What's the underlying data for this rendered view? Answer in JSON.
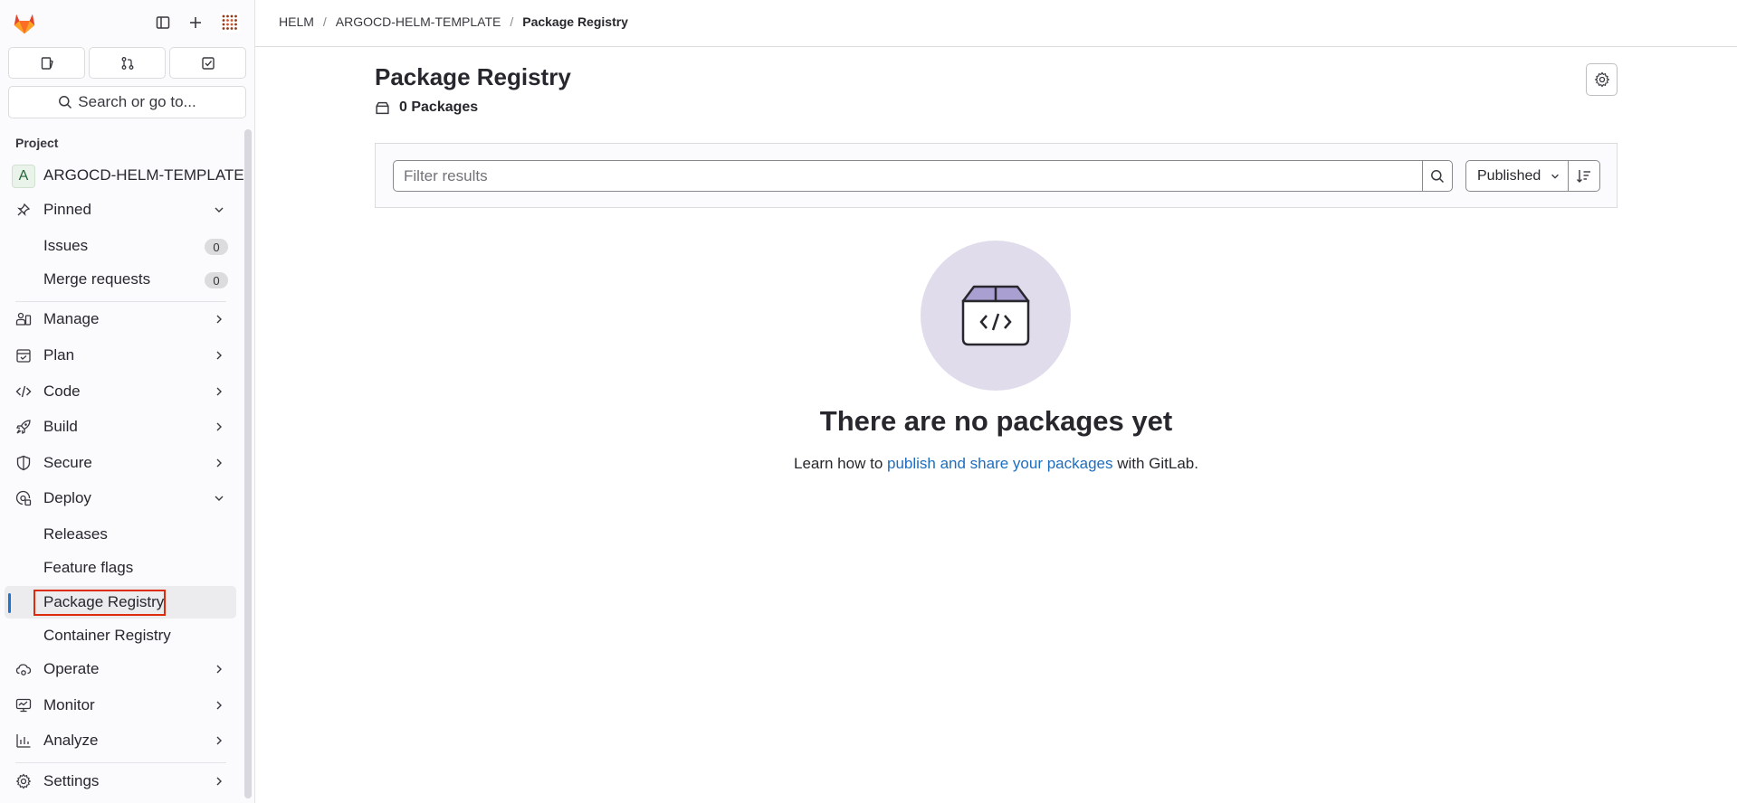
{
  "sidebar": {
    "search_label": "Search or go to...",
    "section_title": "Project",
    "project_avatar": "A",
    "project_name": "ARGOCD-HELM-TEMPLATE",
    "pinned": {
      "label": "Pinned",
      "items": [
        {
          "label": "Issues",
          "count": "0"
        },
        {
          "label": "Merge requests",
          "count": "0"
        }
      ]
    },
    "items": {
      "manage": "Manage",
      "plan": "Plan",
      "code": "Code",
      "build": "Build",
      "secure": "Secure",
      "deploy": "Deploy",
      "releases": "Releases",
      "feature_flags": "Feature flags",
      "package_registry": "Package Registry",
      "container_registry": "Container Registry",
      "operate": "Operate",
      "monitor": "Monitor",
      "analyze": "Analyze",
      "settings": "Settings"
    }
  },
  "breadcrumb": [
    "HELM",
    "ARGOCD-HELM-TEMPLATE",
    "Package Registry"
  ],
  "main": {
    "title": "Package Registry",
    "package_count": "0 Packages",
    "filter_placeholder": "Filter results",
    "sort_label": "Published",
    "empty_title": "There are no packages yet",
    "empty_desc_before": "Learn how to ",
    "empty_desc_link": "publish and share your packages",
    "empty_desc_after": " with GitLab."
  },
  "colors": {
    "accent": "#1f75cb",
    "link": "#1f6dbd",
    "highlight": "#dd2b0e",
    "illustration_bg": "#e1dcec",
    "illustration_fill": "#a99fd0"
  }
}
